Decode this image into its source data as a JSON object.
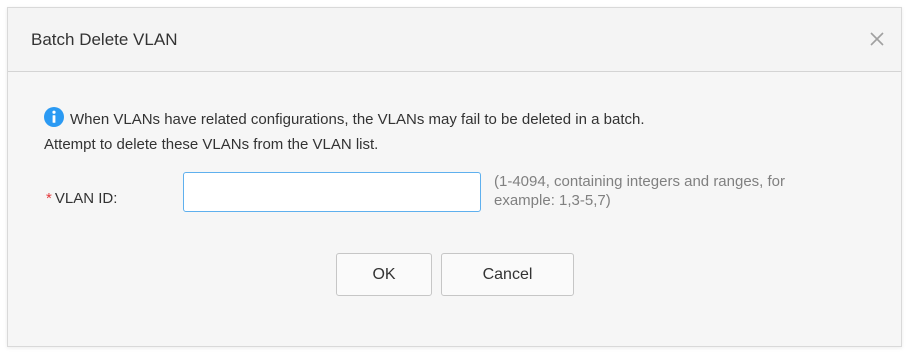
{
  "dialog": {
    "title": "Batch Delete VLAN",
    "close_icon": "close-icon"
  },
  "notice": {
    "icon": "info-icon",
    "icon_color": "#2b9af3",
    "line1": "When VLANs have related configurations, the VLANs may fail to be deleted in a batch.",
    "line2": "Attempt to delete these VLANs from the VLAN list."
  },
  "form": {
    "required_mark": "*",
    "vlan_id_label": "VLAN ID:",
    "vlan_id_value": "",
    "vlan_id_placeholder": "",
    "hint": "(1-4094, containing integers and ranges, for example: 1,3-5,7)"
  },
  "buttons": {
    "ok_label": "OK",
    "cancel_label": "Cancel"
  }
}
